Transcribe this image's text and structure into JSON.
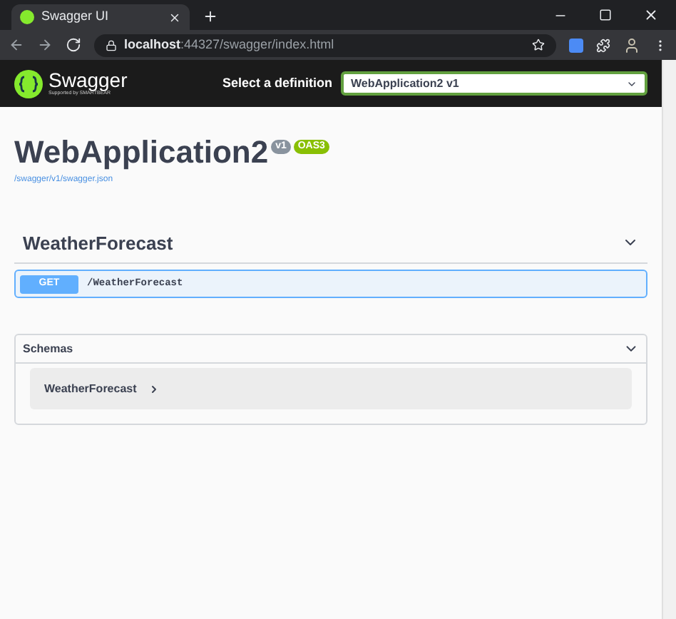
{
  "browser": {
    "tab_title": "Swagger UI",
    "url": "**localhost**:44327/swagger/index.html"
  },
  "header": {
    "logo_text": "Swagger",
    "logo_sub": "Supported by SMARTBEAR",
    "definition_label": "Select a definition",
    "definition_value": "WebApplication2 v1"
  },
  "info": {
    "title": "WebApplication2",
    "badges": [
      {
        "text": "v1",
        "color": "#89939e"
      },
      {
        "text": "OAS3",
        "color": "#89bf04"
      }
    ],
    "link": "/swagger/v1/swagger.json"
  },
  "tags": [
    {
      "name": "WeatherForecast",
      "expanded": true,
      "operations": [
        {
          "method": "GET",
          "path": "/WeatherForecast"
        }
      ]
    }
  ],
  "schemas": {
    "title": "Schemas",
    "expanded": true,
    "models": [
      {
        "name": "WeatherForecast",
        "expanded": false
      }
    ]
  }
}
